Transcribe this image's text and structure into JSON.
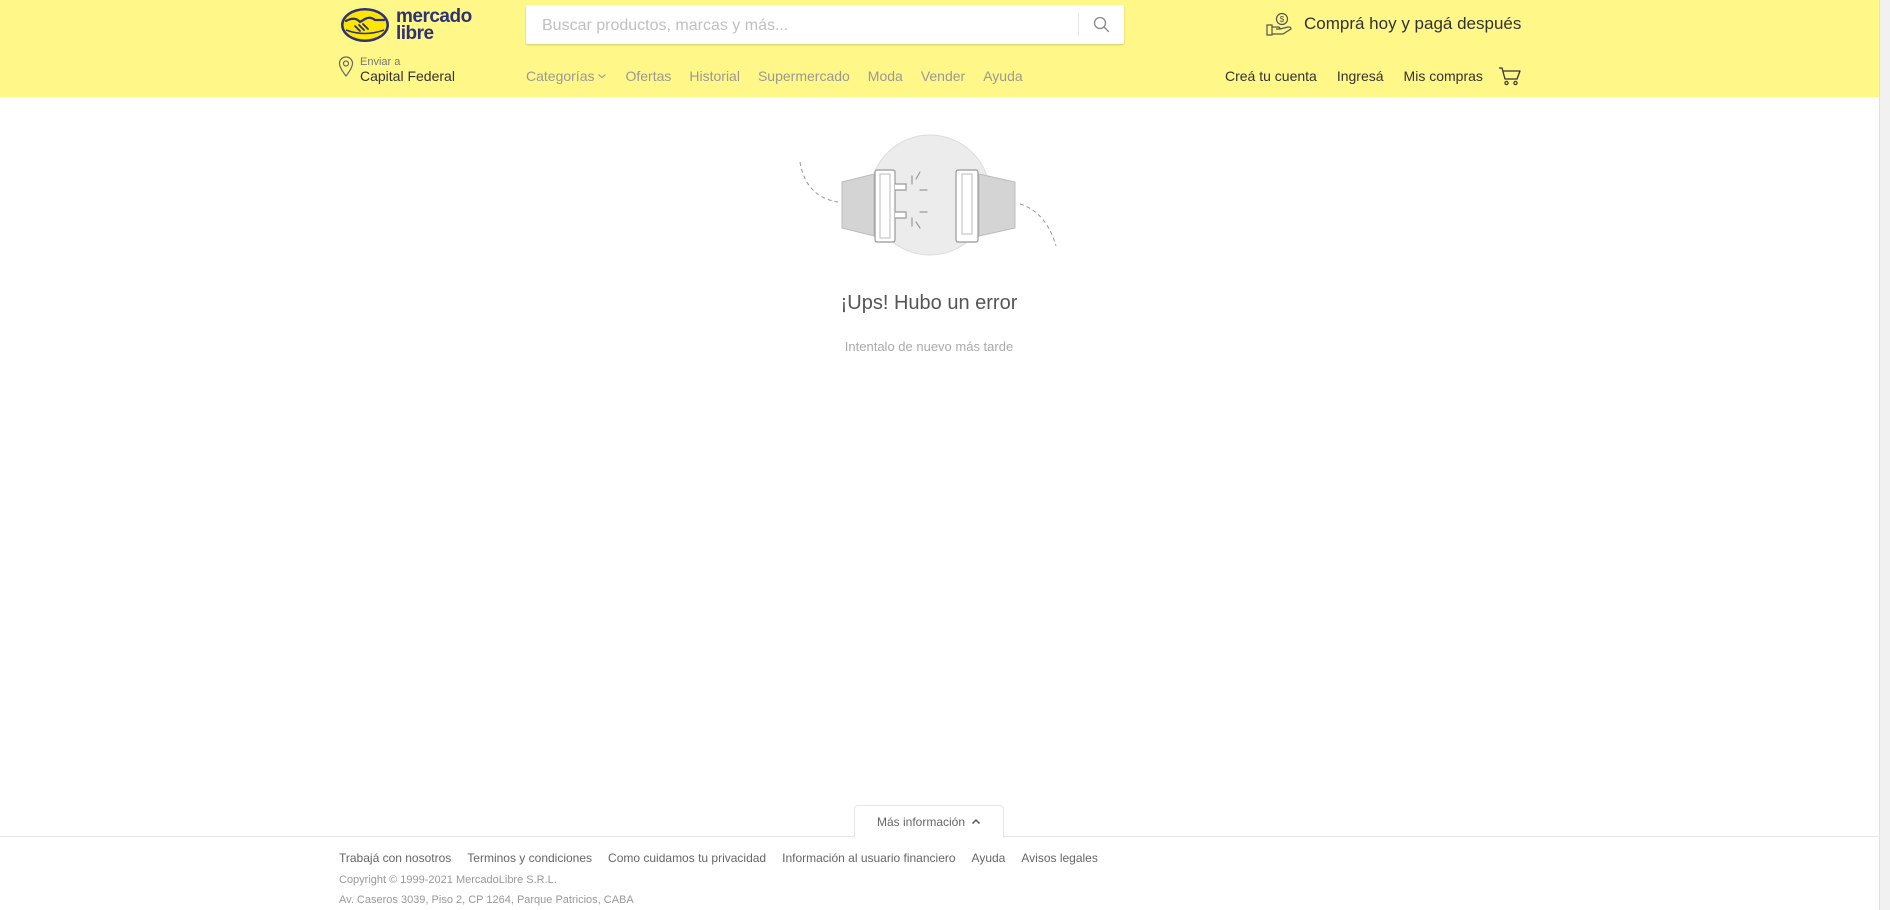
{
  "header": {
    "logo_line1": "mercado",
    "logo_line2": "libre",
    "search_placeholder": "Buscar productos, marcas y más...",
    "promo_text": "Comprá hoy y pagá después",
    "location_label": "Enviar a",
    "location_city": "Capital Federal",
    "nav": [
      "Categorías",
      "Ofertas",
      "Historial",
      "Supermercado",
      "Moda",
      "Vender",
      "Ayuda"
    ],
    "account": [
      "Creá tu cuenta",
      "Ingresá",
      "Mis compras"
    ],
    "colors": {
      "background": "#fff787",
      "logo_blue": "#2d3277"
    }
  },
  "error": {
    "title": "¡Ups! Hubo un error",
    "subtitle": "Intentalo de nuevo más tarde"
  },
  "footer": {
    "more_info": "Más información",
    "links": [
      "Trabajá con nosotros",
      "Terminos y condiciones",
      "Como cuidamos tu privacidad",
      "Información al usuario financiero",
      "Ayuda",
      "Avisos legales"
    ],
    "copyright": "Copyright © 1999-2021 MercadoLibre S.R.L.",
    "address": "Av. Caseros 3039, Piso 2, CP 1264, Parque Patricios, CABA"
  },
  "icons": [
    "logo-handshake-icon",
    "search-icon",
    "payment-hand-icon",
    "location-pin-icon",
    "chevron-down-icon",
    "cart-icon",
    "chevron-up-icon",
    "disconnected-plug-icon"
  ]
}
